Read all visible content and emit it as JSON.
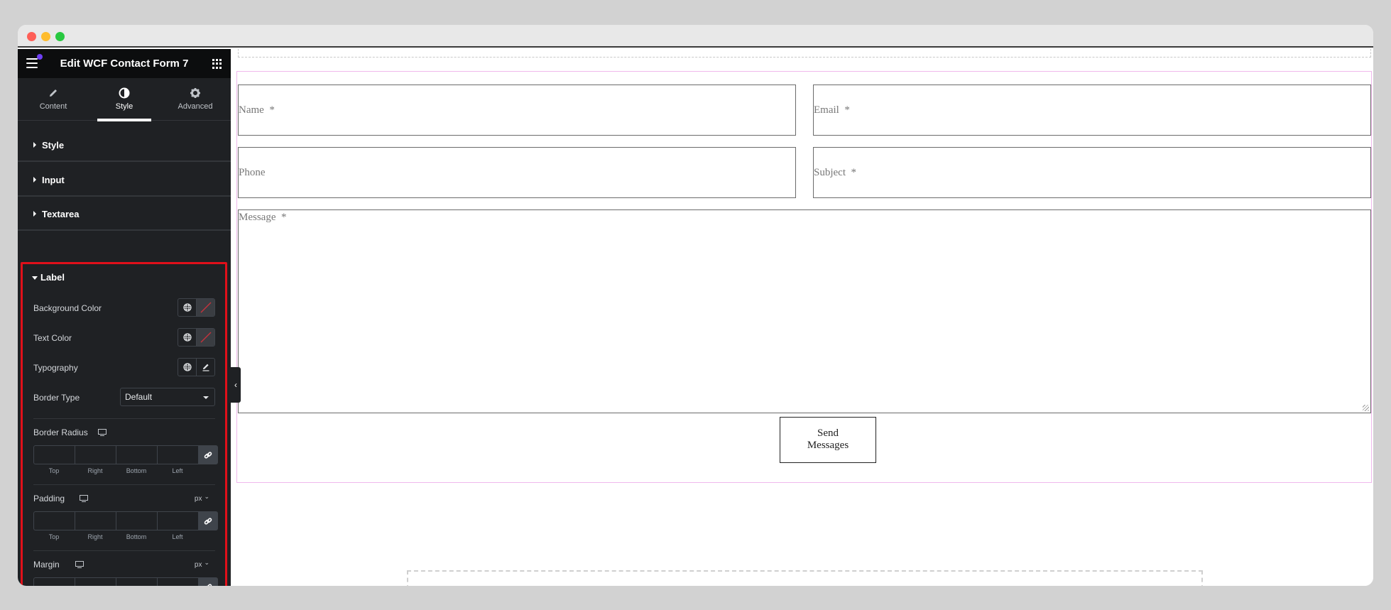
{
  "window": {
    "controls": [
      "close",
      "minimize",
      "maximize"
    ]
  },
  "sidebar": {
    "title": "Edit WCF Contact Form 7",
    "menu_icon": "hamburger-icon",
    "apps_icon": "grid-icon",
    "tabs": [
      {
        "label": "Content",
        "icon": "pencil-icon",
        "active": false
      },
      {
        "label": "Style",
        "icon": "contrast-icon",
        "active": true
      },
      {
        "label": "Advanced",
        "icon": "gear-icon",
        "active": false
      }
    ],
    "sections": [
      {
        "label": "Style",
        "expanded": false
      },
      {
        "label": "Input",
        "expanded": false
      },
      {
        "label": "Textarea",
        "expanded": false
      }
    ],
    "label_section": {
      "title": "Label",
      "expanded": true,
      "background_color": "Background Color",
      "text_color": "Text Color",
      "typography": "Typography",
      "border_type": {
        "label": "Border Type",
        "value": "Default"
      },
      "border_radius": {
        "label": "Border Radius"
      },
      "padding": {
        "label": "Padding",
        "unit": "px"
      },
      "margin": {
        "label": "Margin",
        "unit": "px"
      },
      "dimension_labels": [
        "Top",
        "Right",
        "Bottom",
        "Left"
      ]
    },
    "highlight_color": "#e0101a"
  },
  "form": {
    "fields": {
      "name": "Name  *",
      "email": "Email  *",
      "phone": "Phone",
      "subject": "Subject  *",
      "message": "Message  *"
    },
    "submit_line1": "Send",
    "submit_line2": "Messages",
    "selection_color": "#f0b8ec"
  }
}
